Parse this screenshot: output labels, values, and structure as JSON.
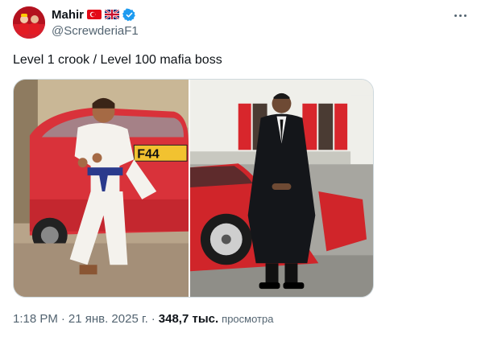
{
  "author": {
    "display_name": "Mahir",
    "handle": "@ScrewderiaF1",
    "flags": [
      "turkey-flag",
      "uk-flag"
    ],
    "verified": true
  },
  "tweet": {
    "text": "Level 1 crook / Level 100 mafia boss"
  },
  "media": {
    "left_photo": {
      "plate_text": "F44"
    },
    "right_photo": {}
  },
  "meta": {
    "time": "1:18 PM",
    "separator": "·",
    "date": "21 янв. 2025 г.",
    "views_count": "348,7 тыс.",
    "views_label": "просмотра"
  },
  "colors": {
    "text_primary": "#0f1419",
    "text_secondary": "#536471",
    "verified_blue": "#1d9bf0",
    "border": "#cfd9de"
  }
}
